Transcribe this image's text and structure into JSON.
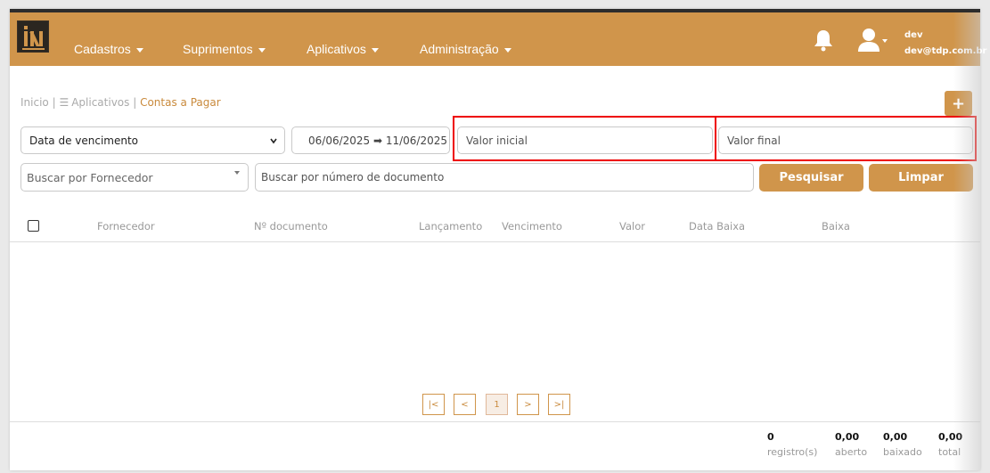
{
  "nav": {
    "items": [
      "Cadastros",
      "Suprimentos",
      "Aplicativos",
      "Administração"
    ]
  },
  "user": {
    "name": "dev",
    "email": "dev@tdp.com.br"
  },
  "breadcrumb": {
    "home": "Inicio |",
    "apps": "Aplicativos |",
    "current": "Contas a Pagar"
  },
  "add_button": "+",
  "filters": {
    "date_type": "Data de vencimento",
    "date_range": "06/06/2025 ➡ 11/06/2025",
    "valor_inicial_placeholder": "Valor inicial",
    "valor_final_placeholder": "Valor final",
    "fornecedor_placeholder": "Buscar por Fornecedor",
    "documento_placeholder": "Buscar por número de documento",
    "search_label": "Pesquisar",
    "clear_label": "Limpar"
  },
  "table": {
    "columns": [
      "Fornecedor",
      "Nº documento",
      "Lançamento",
      "Vencimento",
      "Valor",
      "Data Baixa",
      "Baixa"
    ]
  },
  "pagination": {
    "first": "|<",
    "prev": "<",
    "page": "1",
    "next": ">",
    "last": ">|"
  },
  "summary": [
    {
      "value": "0",
      "label": "registro(s)"
    },
    {
      "value": "0,00",
      "label": "aberto"
    },
    {
      "value": "0,00",
      "label": "baixado"
    },
    {
      "value": "0,00",
      "label": "total"
    }
  ],
  "colors": {
    "brand": "#d0954b",
    "highlight": "#e00000"
  },
  "icons": [
    "bell-icon",
    "user-icon",
    "menu-icon",
    "chevron-down-icon"
  ]
}
